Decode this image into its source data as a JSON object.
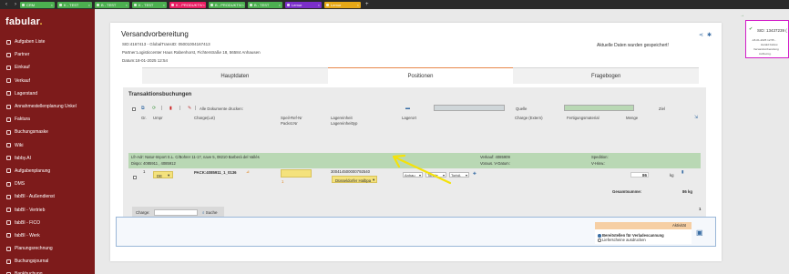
{
  "tabs": [
    {
      "label": "CRM",
      "color": "#4caf50"
    },
    {
      "label": "K - TEST",
      "color": "#4caf50"
    },
    {
      "label": "B - TEST",
      "color": "#4caf50"
    },
    {
      "label": "K - TEST",
      "color": "#4caf50"
    },
    {
      "label": "K - PRODUKTIV",
      "color": "#e91e63"
    },
    {
      "label": "B - PRODUKTIV",
      "color": "#4caf50"
    },
    {
      "label": "B - TEST",
      "color": "#4caf50"
    },
    {
      "label": "Lemur",
      "color": "#7b2fc9"
    },
    {
      "label": "Lemur",
      "color": "#e6a817"
    }
  ],
  "sidebar": {
    "logo": "fabular",
    "items": [
      {
        "label": "Aufgaben Liste"
      },
      {
        "label": "Partner"
      },
      {
        "label": "Einkauf"
      },
      {
        "label": "Verkauf"
      },
      {
        "label": "Lagerstand"
      },
      {
        "label": "Annahmestellenplanung Unkel"
      },
      {
        "label": "Faktura"
      },
      {
        "label": "Buchungsmaske"
      },
      {
        "label": "Wiki"
      },
      {
        "label": "fabby.AI"
      },
      {
        "label": "Aufgabenplanung"
      },
      {
        "label": "DMS"
      },
      {
        "label": "fabBI - Außendienst"
      },
      {
        "label": "fabBI - Vertrieb"
      },
      {
        "label": "fabBI - FICO"
      },
      {
        "label": "fabBI - Werk"
      },
      {
        "label": "Planungsrechnung"
      },
      {
        "label": "Buchungsjournal"
      },
      {
        "label": "Bankbuchung"
      }
    ]
  },
  "page": {
    "title": "Versandvorbereitung",
    "sid_line": "SID:4167413 - GlobalTransID: 05001004167413",
    "partner_line": "Partner:Logisticcenter Haus Rabenhorst, Fichterstraße 18, 56584 Anhausen",
    "datum_line": "Datum:18-01-2025 12:54",
    "saved_msg": "Aktuelle Daten wurden gespeichert!",
    "tabs": {
      "hauptdaten": "Hauptdaten",
      "positionen": "Positionen",
      "fragebogen": "Fragebogen"
    }
  },
  "panel": {
    "title": "Transaktionsbuchungen",
    "toolbar_label": "Alle Dokumente drucken:",
    "quelle_label": "Quelle",
    "ziel_label": "Ziel",
    "headers": {
      "gr": "Gr.",
      "umpr": "Umpr",
      "charge_lot": "Charge(Lot)",
      "speil_ref": "Speil-Ref-Nr",
      "packst": "Packst.Nr",
      "lagereinheit": "Lagereinheit",
      "lagereinheittyp": "Lagereinheittyp",
      "lagerort": "Lagerort",
      "charge_extern": "Charge (Extern)",
      "fertigungsmaterial": "Fertigungsmaterial",
      "menge": "Menge"
    },
    "green": {
      "lfr_adr": "Lfr-Adr: Natur-Import S.L. C/Bohrer 11-17, nave 5, 08210 Barberá del Vallés",
      "dispo": "Dispo: 4085911 , 4085912",
      "verkauf": "Verkauf: 4085909",
      "voraus": "Voraus. V-Datum:",
      "spedition": "Spedition:",
      "vhinw": "V-Hinw.:"
    },
    "row": {
      "gr": "1",
      "umpr": "DE",
      "charge": "PACK:4085911_1_0136",
      "packst": "1",
      "lagereinheit": "300414500000792540",
      "lagereinheittyp": "Düsseldorfer Halbpa",
      "lagerort1": "Anhau",
      "lagerort2": "Toreile",
      "lagerort3": "TorbA",
      "menge": "86",
      "unit": "kg"
    },
    "gesamtsumme_label": "Gesamtsumme:",
    "gesamtsumme_value": "86 kg",
    "count": "1",
    "charge_label": "Charge:",
    "search_label": "Suche"
  },
  "activity": {
    "title": "Aktivität",
    "option1": "Bereitstellen für Verladescannung",
    "option2": "Lieferscheine ausdrucken"
  },
  "rightpanel": {
    "sid": "SID: 13437239 (",
    "line1": "-18-01-2025 12:55 - ",
    "line2": "Harald Faltow",
    "line3": "Versandvorbereitung",
    "line4": "zeitbezog."
  }
}
